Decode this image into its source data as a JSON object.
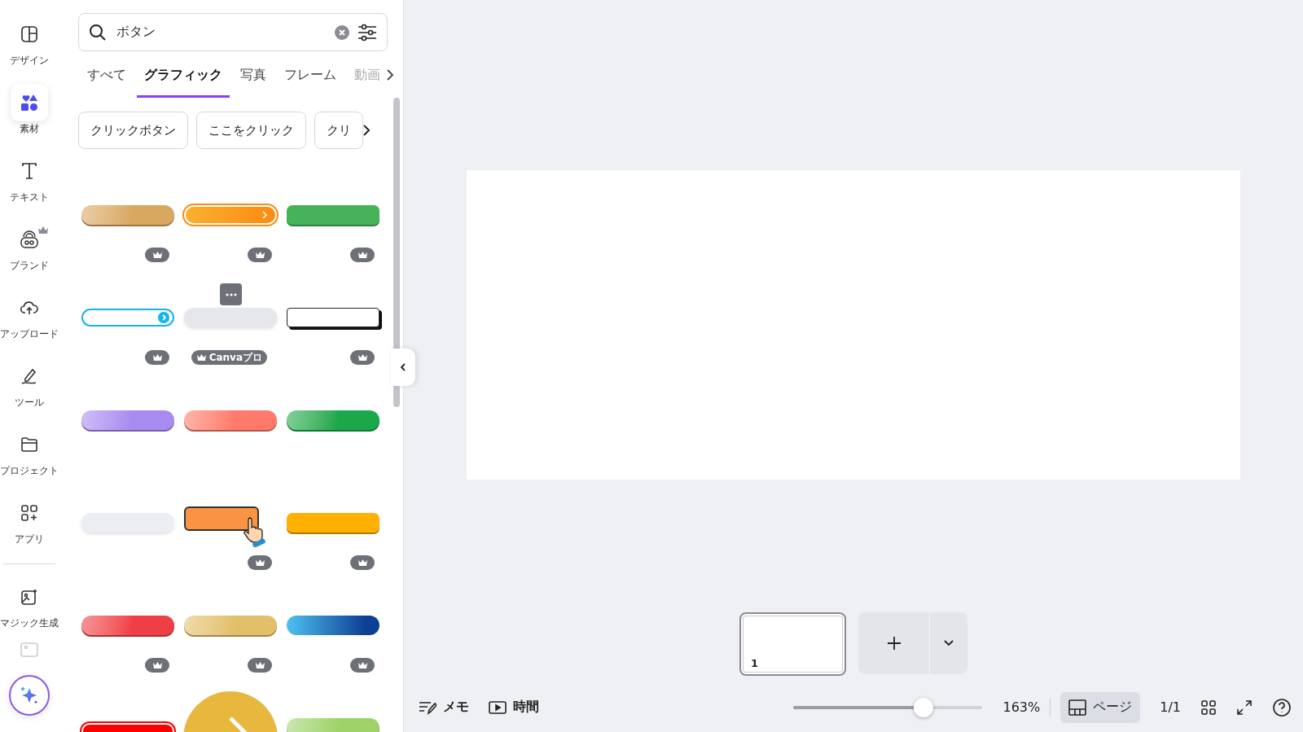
{
  "rail": {
    "items": [
      {
        "label": "デザイン",
        "selected": false,
        "crown": false
      },
      {
        "label": "素材",
        "selected": true,
        "crown": false
      },
      {
        "label": "テキスト",
        "selected": false,
        "crown": false
      },
      {
        "label": "ブランド",
        "selected": false,
        "crown": true
      },
      {
        "label": "アップロード",
        "selected": false,
        "crown": false
      },
      {
        "label": "ツール",
        "selected": false,
        "crown": false
      },
      {
        "label": "プロジェクト",
        "selected": false,
        "crown": false
      },
      {
        "label": "アプリ",
        "selected": false,
        "crown": false
      }
    ],
    "extra": {
      "label": "マジック生成"
    }
  },
  "panel": {
    "search": {
      "value": "ボタン"
    },
    "tabs": [
      {
        "label": "すべて",
        "selected": false,
        "disabled": false
      },
      {
        "label": "グラフィック",
        "selected": true,
        "disabled": false
      },
      {
        "label": "写真",
        "selected": false,
        "disabled": false
      },
      {
        "label": "フレーム",
        "selected": false,
        "disabled": false
      },
      {
        "label": "動画",
        "selected": false,
        "disabled": true
      }
    ],
    "chips": [
      "クリックボタン",
      "ここをクリック",
      "クリ"
    ],
    "graphics": [
      {
        "kind": "pill",
        "color": "#d9a860",
        "premium": true,
        "hovered": false
      },
      {
        "kind": "arrow-pill",
        "color": "#fb8a10",
        "premium": true,
        "hovered": false
      },
      {
        "kind": "rect",
        "color": "#46b35a",
        "premium": true,
        "hovered": false
      },
      {
        "kind": "outline-arrow",
        "color": "#12b3ee",
        "premium": true,
        "hovered": false
      },
      {
        "kind": "soft",
        "color": "#e6e7ec",
        "premium": true,
        "hovered": true,
        "badge": "Canvaプロ"
      },
      {
        "kind": "shadow-rect",
        "color": "#ffffff",
        "premium": true,
        "hovered": false
      },
      {
        "kind": "pill",
        "color": "#a98af0",
        "premium": false,
        "hovered": false
      },
      {
        "kind": "pill",
        "color": "#ff7a6a",
        "premium": false,
        "hovered": false
      },
      {
        "kind": "pill",
        "color": "#1aa84a",
        "premium": false,
        "hovered": false
      },
      {
        "kind": "soft",
        "color": "#eceef3",
        "premium": false,
        "hovered": false
      },
      {
        "kind": "cursor",
        "color": "#fb9344",
        "premium": true,
        "hovered": false
      },
      {
        "kind": "rect",
        "color": "#ffb000",
        "premium": true,
        "hovered": false
      },
      {
        "kind": "pill",
        "color": "#ef3e46",
        "premium": true,
        "hovered": false
      },
      {
        "kind": "pill",
        "color": "#e2c06a",
        "premium": true,
        "hovered": false
      },
      {
        "kind": "gradient-rect",
        "color": "#0d3f95",
        "premium": true,
        "hovered": false
      },
      {
        "kind": "outline-red",
        "color": "#ff0000",
        "hovered": false
      },
      {
        "kind": "circle",
        "color": "#e8b73e",
        "hovered": false
      },
      {
        "kind": "pill",
        "color": "#9fd36a",
        "hovered": false
      }
    ]
  },
  "pages": {
    "thumbnails": [
      {
        "number": "1",
        "selected": true
      }
    ]
  },
  "bottom_bar": {
    "notes": "メモ",
    "timing": "時間",
    "zoom": {
      "level": 0.69,
      "reading": "163%"
    },
    "pages_button": "ページ",
    "page_count": "1/1"
  }
}
